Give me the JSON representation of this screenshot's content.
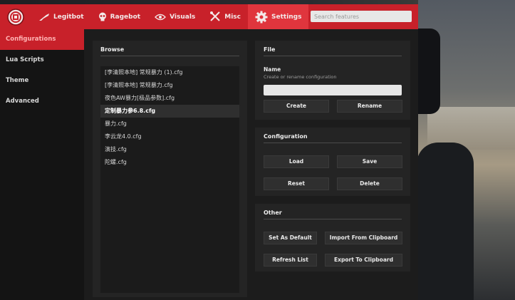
{
  "nav": {
    "tabs": [
      {
        "label": "Legitbot",
        "icon": "rifle-icon"
      },
      {
        "label": "Ragebot",
        "icon": "skull-icon"
      },
      {
        "label": "Visuals",
        "icon": "eye-icon"
      },
      {
        "label": "Misc",
        "icon": "tools-icon"
      },
      {
        "label": "Settings",
        "icon": "gear-icon"
      }
    ],
    "active_tab": "Settings",
    "search_placeholder": "Search features"
  },
  "sidebar": {
    "items": [
      {
        "label": "Configurations"
      },
      {
        "label": "Lua Scripts"
      },
      {
        "label": "Theme"
      },
      {
        "label": "Advanced"
      }
    ],
    "active_item": "Configurations"
  },
  "browse": {
    "title": "Browse",
    "files": [
      "[李清照本地] 常规暴力 (1).cfg",
      "[李清照本地] 常规暴力.cfg",
      "夜色AW暴力[极品参数].cfg",
      "定制暴力参6.8.cfg",
      "暴力.cfg",
      "李云龙4.0.cfg",
      "演技.cfg",
      "陀螺.cfg"
    ],
    "selected_index": 3
  },
  "file": {
    "title": "File",
    "name_label": "Name",
    "name_hint": "Create or rename configuration",
    "name_value": "",
    "create_label": "Create",
    "rename_label": "Rename"
  },
  "configuration": {
    "title": "Configuration",
    "load_label": "Load",
    "save_label": "Save",
    "reset_label": "Reset",
    "delete_label": "Delete"
  },
  "other": {
    "title": "Other",
    "set_default_label": "Set As Default",
    "import_label": "Import From Clipboard",
    "refresh_label": "Refresh List",
    "export_label": "Export To Clipboard"
  },
  "colors": {
    "accent": "#c8212a",
    "accent_active_tab": "#e0353d",
    "panel": "#242424",
    "window": "#161616"
  }
}
